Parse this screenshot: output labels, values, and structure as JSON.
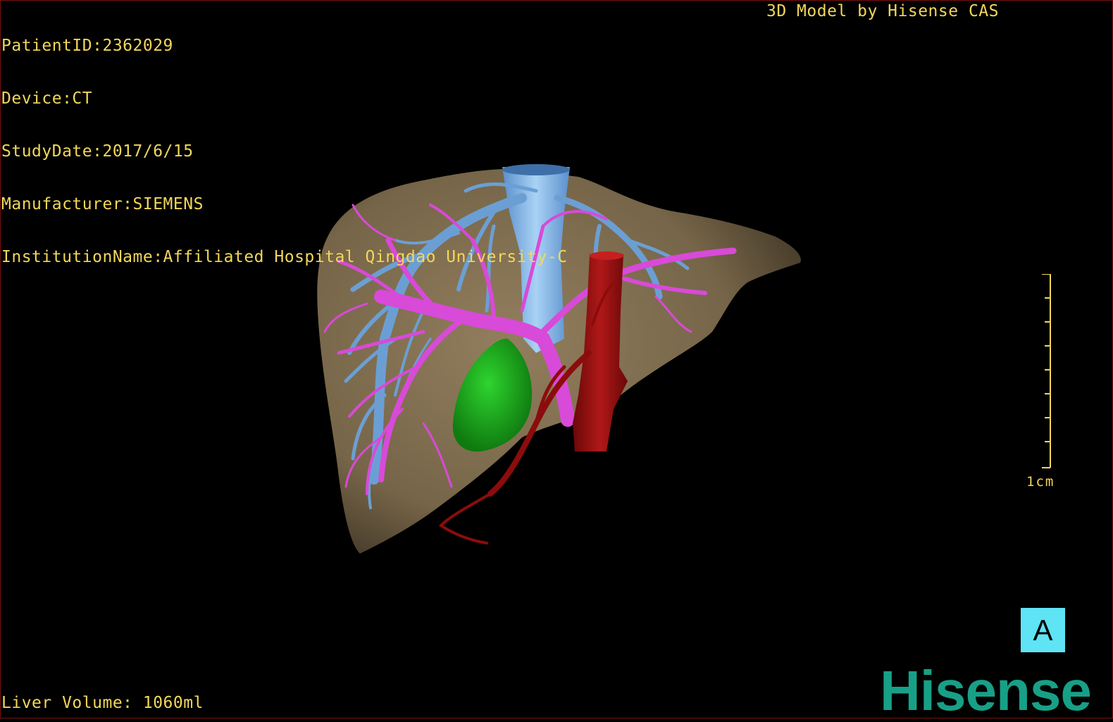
{
  "header": {
    "patient_id": "PatientID:2362029",
    "device": "Device:CT",
    "study_date": "StudyDate:2017/6/15",
    "manufacturer": "Manufacturer:SIEMENS",
    "institution": "InstitutionName:Affiliated Hospital Qingdao University-C",
    "model_credit": "3D Model by Hisense CAS"
  },
  "footer": {
    "liver_volume": "Liver Volume: 1060ml"
  },
  "scale_bar": {
    "label": "1cm",
    "ticks": 9
  },
  "view": {
    "orientation_badge": "A"
  },
  "brand": {
    "logo_text": "Hisense",
    "logo_color": "#17a087"
  },
  "colors": {
    "overlay_text": "#f2d75a",
    "liver": "#8a7555",
    "hepatic_veins": "#6b9fd4",
    "portal_vein": "#d84ad8",
    "artery": "#8c0c0c",
    "gallbladder": "#1aa51a",
    "badge_background": "#5ee4f5"
  },
  "model_structures": [
    "liver",
    "hepatic-veins",
    "portal-vein",
    "hepatic-artery",
    "gallbladder",
    "inferior-vena-cava"
  ]
}
